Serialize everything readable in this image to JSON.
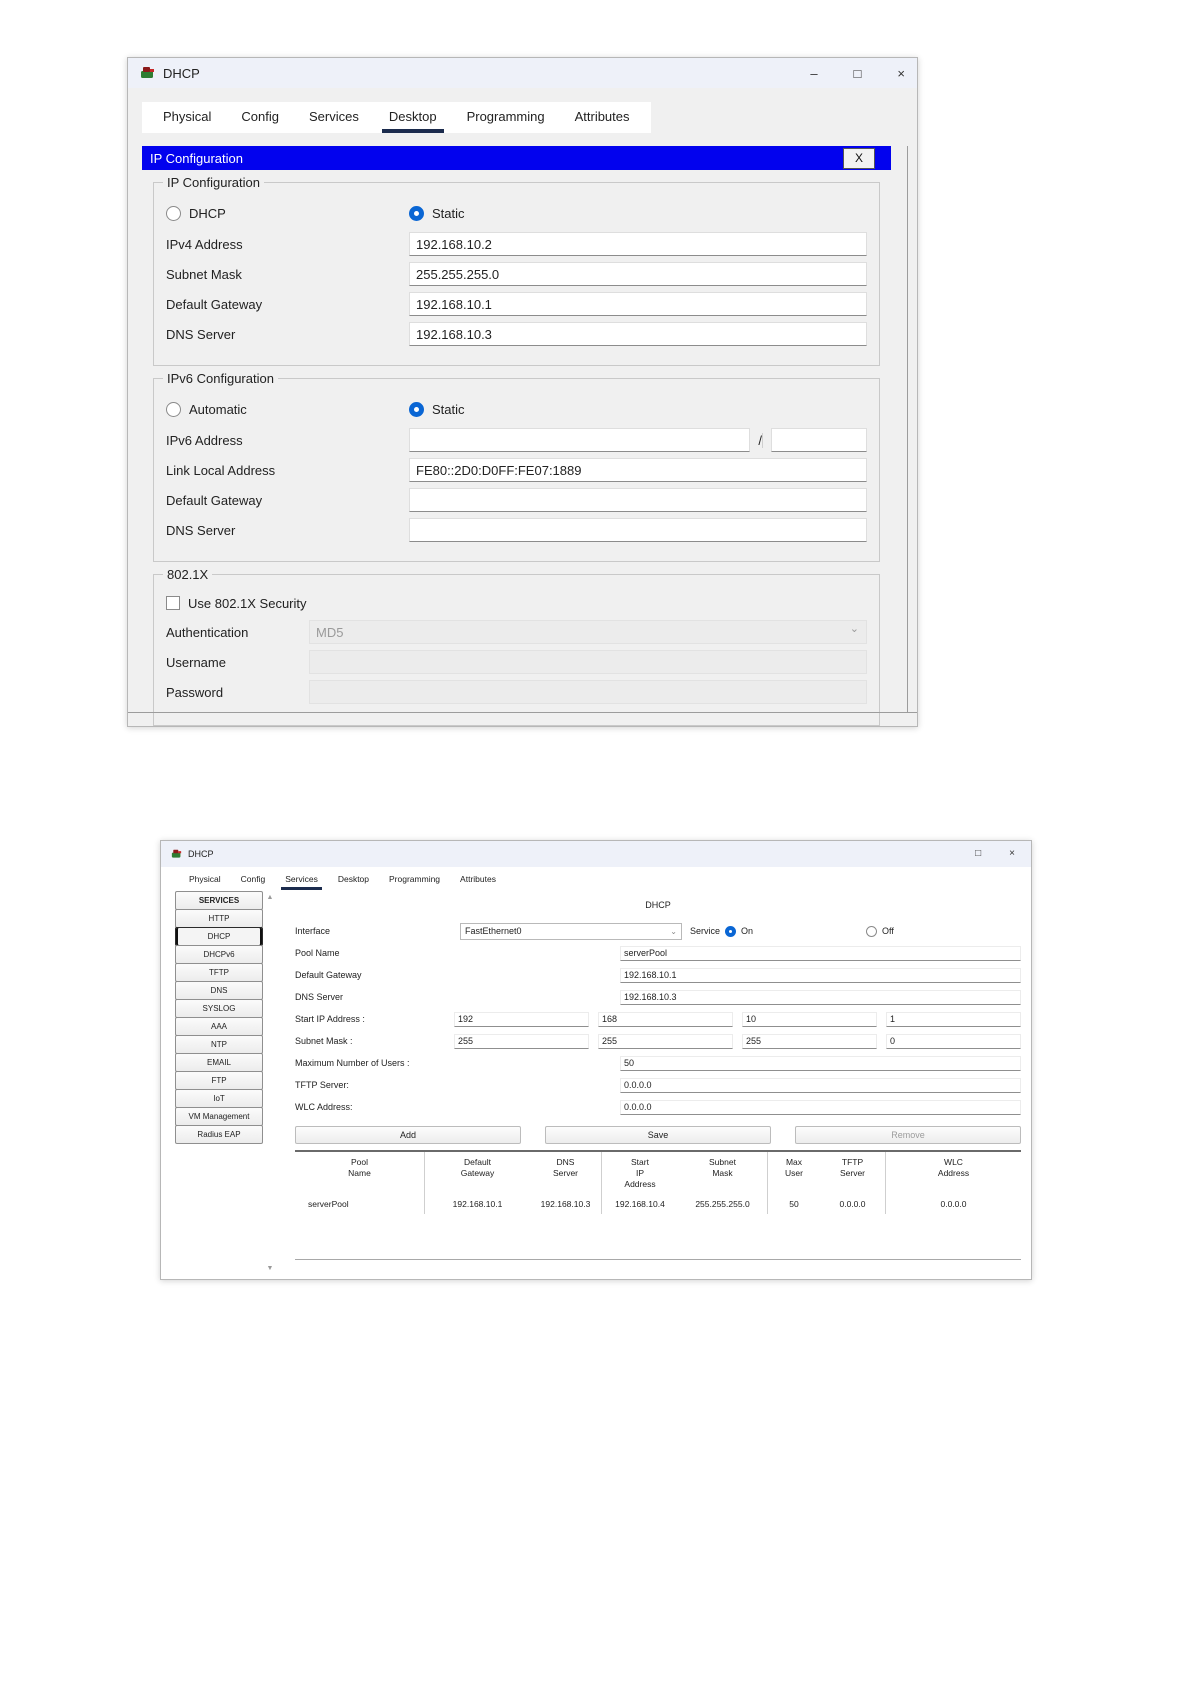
{
  "colors": {
    "banner_blue": "#0202ee",
    "radio_blue": "#0a66d4",
    "tab_underline": "#1b2b4d",
    "titlebar_bg": "#eef1f9"
  },
  "top_window": {
    "title": "DHCP",
    "minimize": "–",
    "maximize": "□",
    "close": "×",
    "tabs": [
      "Physical",
      "Config",
      "Services",
      "Desktop",
      "Programming",
      "Attributes"
    ],
    "active_tab": "Desktop",
    "app": {
      "banner": "IP Configuration",
      "banner_close": "X",
      "ip": {
        "legend": "IP Configuration",
        "dhcp_label": "DHCP",
        "static_label": "Static",
        "rows": [
          {
            "label": "IPv4 Address",
            "value": "192.168.10.2"
          },
          {
            "label": "Subnet Mask",
            "value": "255.255.255.0"
          },
          {
            "label": "Default Gateway",
            "value": "192.168.10.1"
          },
          {
            "label": "DNS Server",
            "value": "192.168.10.3"
          }
        ]
      },
      "ipv6": {
        "legend": "IPv6 Configuration",
        "auto_label": "Automatic",
        "static_label": "Static",
        "address_label": "IPv6 Address",
        "address_value": "",
        "prefix_separator": "/",
        "prefix_value": "",
        "rows": [
          {
            "label": "Link Local Address",
            "value": "FE80::2D0:D0FF:FE07:1889"
          },
          {
            "label": "Default Gateway",
            "value": ""
          },
          {
            "label": "DNS Server",
            "value": ""
          }
        ]
      },
      "dot1x": {
        "legend": "802.1X",
        "checkbox_label": "Use 802.1X Security",
        "auth_label": "Authentication",
        "auth_value": "MD5",
        "username_label": "Username",
        "username_value": "",
        "password_label": "Password",
        "password_value": ""
      }
    }
  },
  "bottom_window": {
    "title": "DHCP",
    "maximize": "□",
    "close": "×",
    "tabs": [
      "Physical",
      "Config",
      "Services",
      "Desktop",
      "Programming",
      "Attributes"
    ],
    "active_tab": "Services",
    "sidebar": {
      "header": "SERVICES",
      "items": [
        "HTTP",
        "DHCP",
        "DHCPv6",
        "TFTP",
        "DNS",
        "SYSLOG",
        "AAA",
        "NTP",
        "EMAIL",
        "FTP",
        "IoT",
        "VM Management",
        "Radius EAP"
      ],
      "selected": "DHCP",
      "scroll_up": "▲",
      "scroll_down": "▼"
    },
    "panel": {
      "title": "DHCP",
      "interface_label": "Interface",
      "interface_value": "FastEthernet0",
      "service_label": "Service",
      "on_label": "On",
      "off_label": "Off",
      "pool_name_label": "Pool Name",
      "pool_name_value": "serverPool",
      "gateway_label": "Default Gateway",
      "gateway_value": "192.168.10.1",
      "dns_label": "DNS Server",
      "dns_value": "192.168.10.3",
      "start_ip_label": "Start IP Address :",
      "start_ip_octets": [
        "192",
        "168",
        "10",
        "1"
      ],
      "subnet_label": "Subnet Mask :",
      "subnet_octets": [
        "255",
        "255",
        "255",
        "0"
      ],
      "max_users_label": "Maximum Number of Users :",
      "max_users_value": "50",
      "tftp_label": "TFTP Server:",
      "tftp_value": "0.0.0.0",
      "wlc_label": "WLC Address:",
      "wlc_value": "0.0.0.0",
      "add_button": "Add",
      "save_button": "Save",
      "remove_button": "Remove",
      "table": {
        "headers": [
          "Pool\nName",
          "Default\nGateway",
          "DNS\nServer",
          "Start\nIP\nAddress",
          "Subnet\nMask",
          "Max\nUser",
          "TFTP\nServer",
          "WLC\nAddress"
        ],
        "rows": [
          {
            "pool": "serverPool",
            "gateway": "192.168.10.1",
            "dns": "192.168.10.3",
            "start_ip": "192.168.10.4",
            "subnet": "255.255.255.0",
            "max_user": "50",
            "tftp": "0.0.0.0",
            "wlc": "0.0.0.0"
          }
        ]
      }
    }
  }
}
